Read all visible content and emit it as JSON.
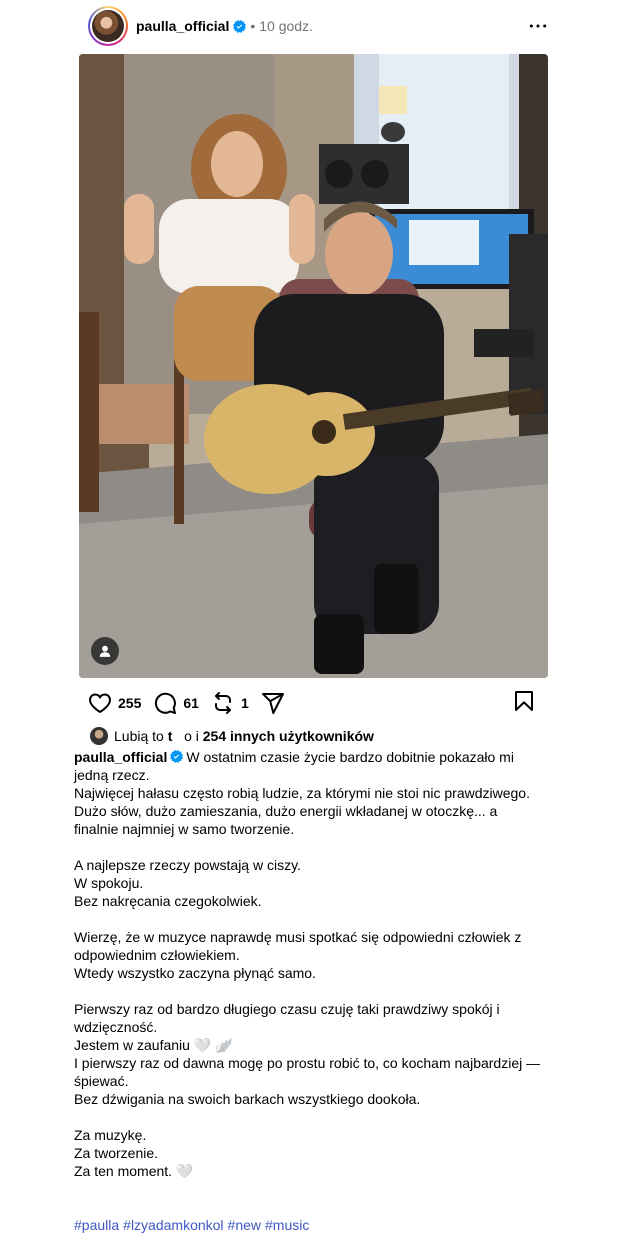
{
  "header": {
    "username": "paulla_official",
    "separator": "•",
    "time": "10 godz."
  },
  "actions": {
    "likes_count": "255",
    "comments_count": "61",
    "reposts_count": "1"
  },
  "likes_line": {
    "prefix": "Lubią to",
    "liker": "t",
    "liker_rest": "o",
    "connector": "i",
    "others": "254 innych użytkowników"
  },
  "caption": {
    "username": "paulla_official",
    "text": "W ostatnim czasie życie bardzo dobitnie pokazało mi jedną rzecz.\nNajwięcej hałasu często robią ludzie, za którymi nie stoi nic prawdziwego.\nDużo słów, dużo zamieszania, dużo energii wkładanej w otoczkę... a finalnie najmniej w samo tworzenie.\n\nA najlepsze rzeczy powstają w ciszy.\nW spokoju.\nBez nakręcania czegokolwiek.\n\nWierzę, że w muzyce naprawdę musi spotkać się odpowiedni człowiek z odpowiednim człowiekiem.\nWtedy wszystko zaczyna płynąć samo.\n\nPierwszy raz od bardzo długiego czasu czuję taki prawdziwy spokój i wdzięczność.\nJestem w zaufaniu 🤍 🪽\nI pierwszy raz od dawna mogę po prostu robić to, co kocham najbardziej — śpiewać.\nBez dźwigania na swoich barkach wszystkiego dookoła.\n\nZa muzykę.\nZa tworzenie.\nZa ten moment. 🤍"
  },
  "hashtags": [
    "#paulla",
    "#lzyadamkonkol",
    "#new",
    "#music"
  ],
  "colors": {
    "verified": "#0095f6",
    "hashtag": "#3f58c4",
    "muted": "#737373"
  },
  "icons": {
    "like": "heart-icon",
    "comment": "comment-icon",
    "repost": "repost-icon",
    "share": "share-icon",
    "save": "bookmark-icon",
    "more": "more-icon",
    "tag": "person-tag-icon"
  }
}
